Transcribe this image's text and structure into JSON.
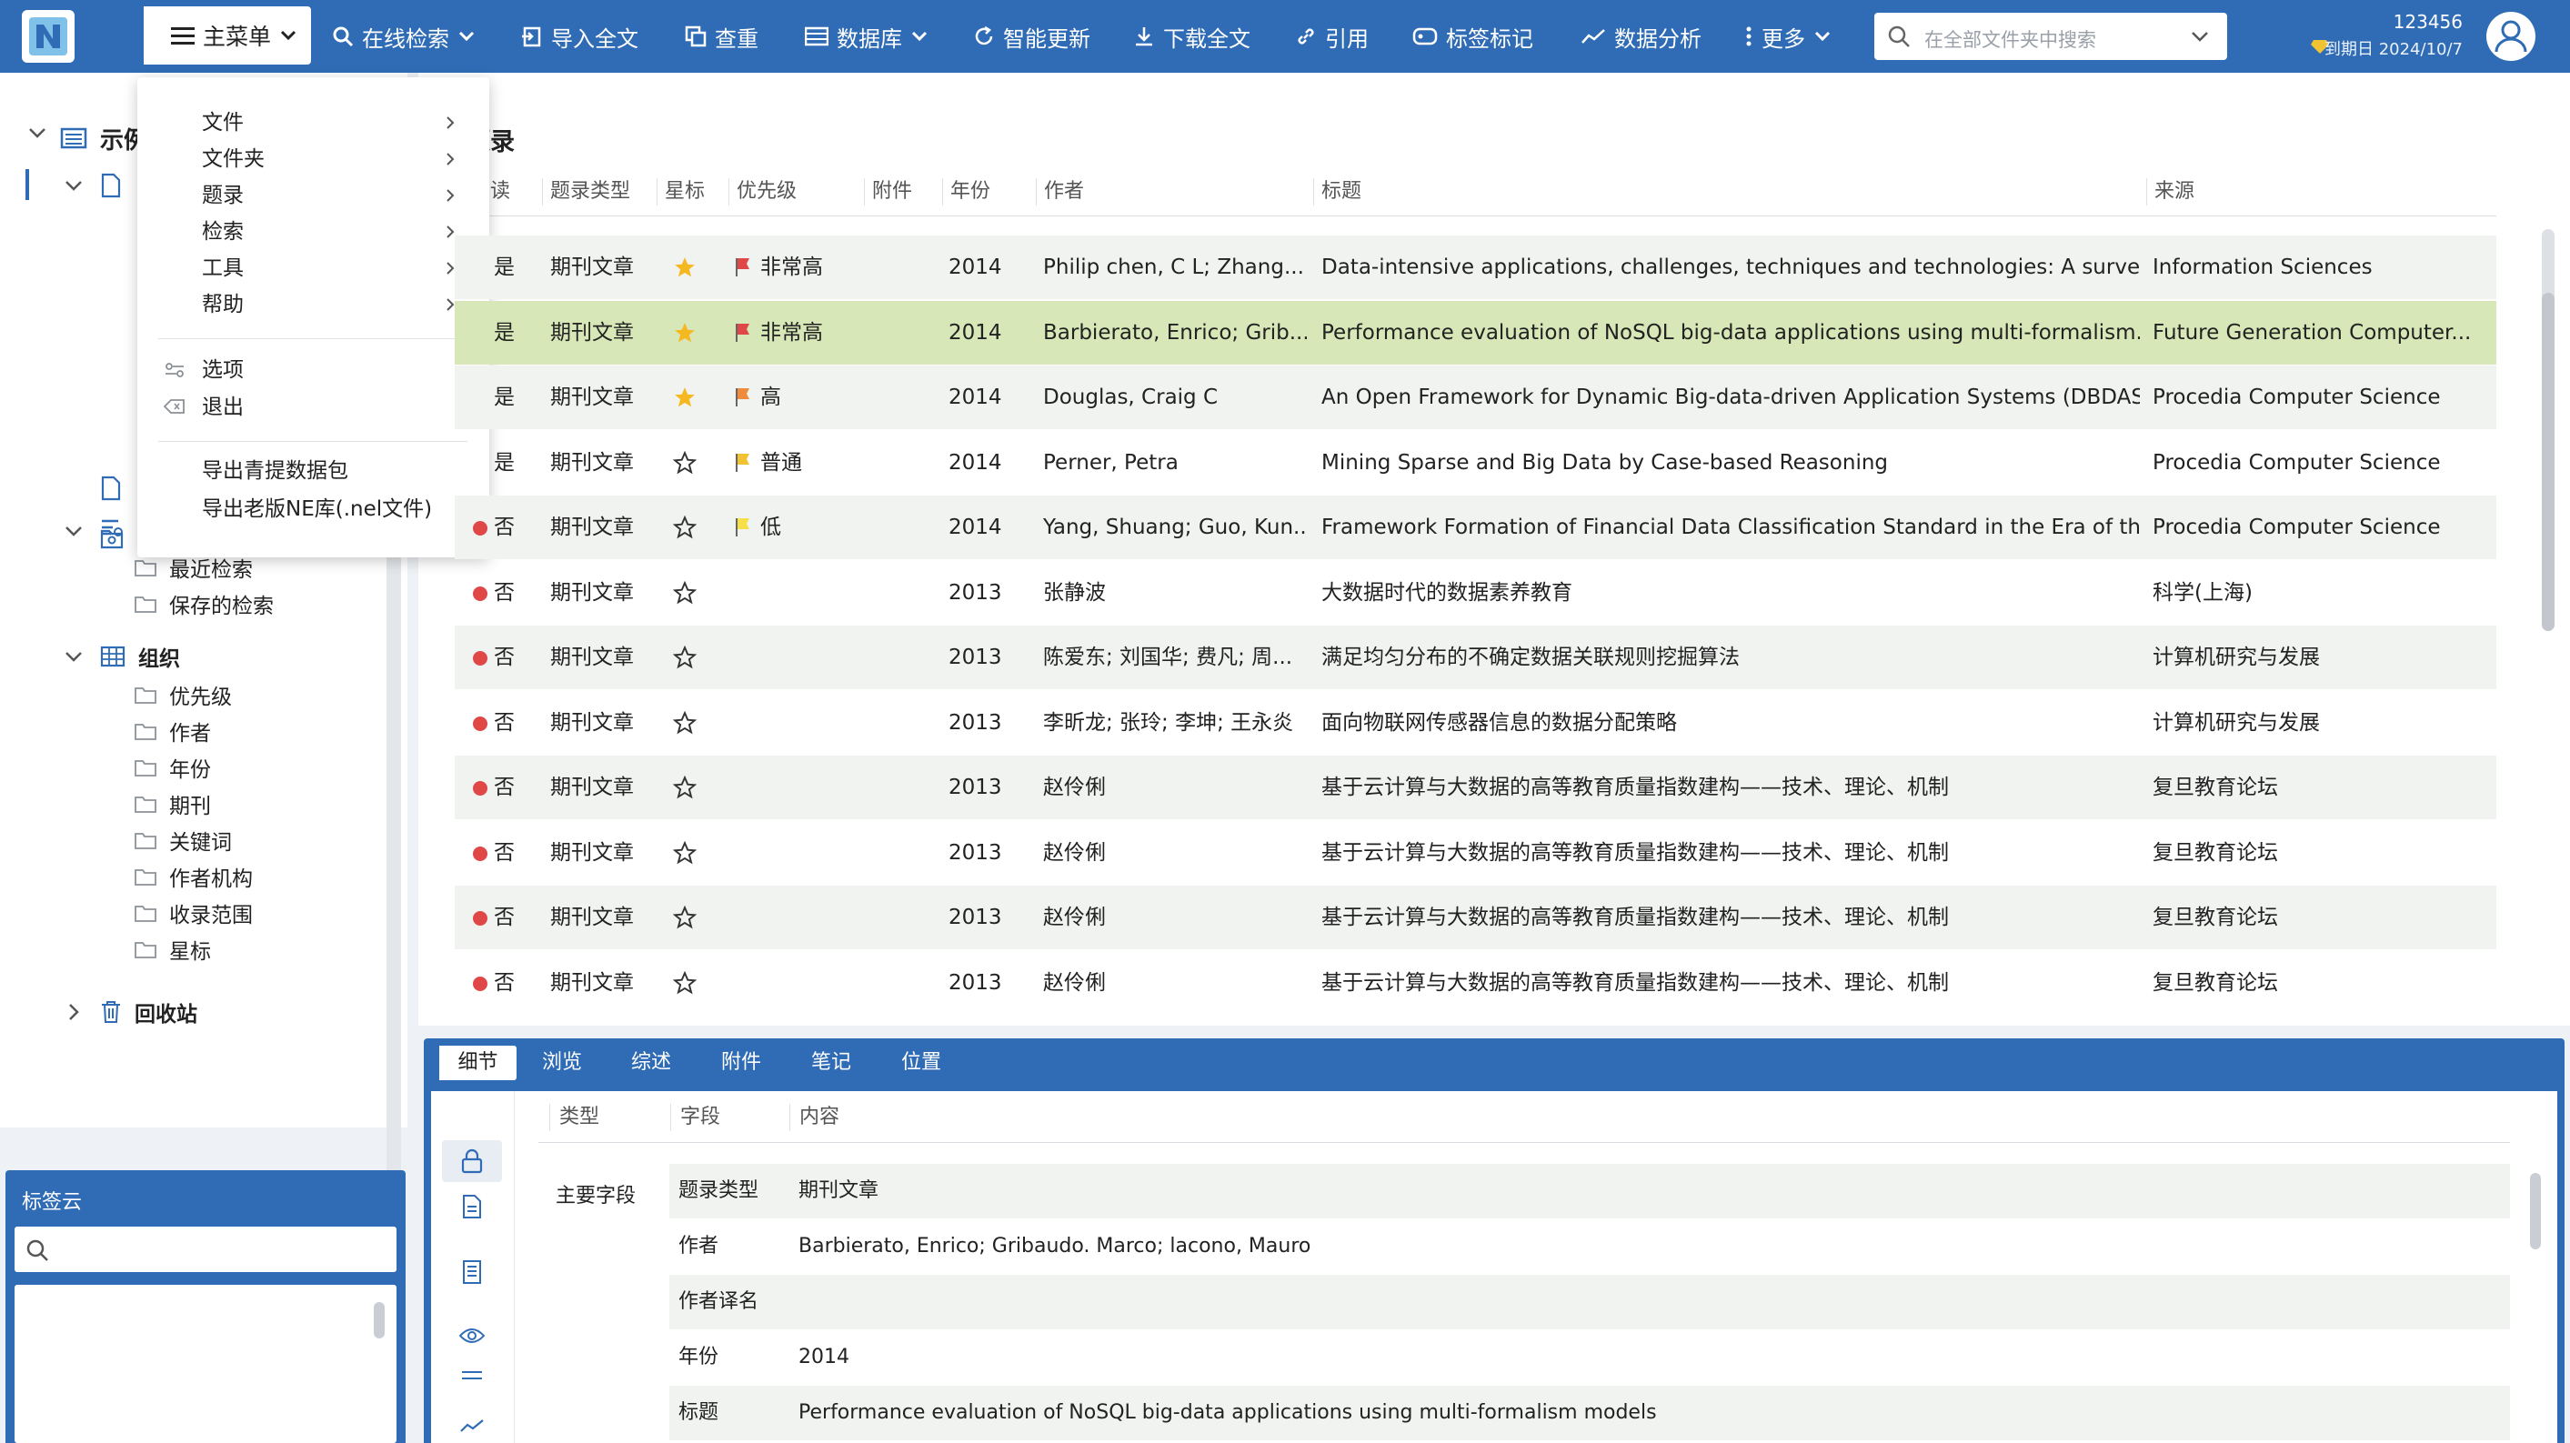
{
  "topbar": {
    "main_menu": "主菜单",
    "online_search": "在线检索",
    "import_fulltext": "导入全文",
    "dedupe": "查重",
    "database": "数据库",
    "smart_update": "智能更新",
    "download_fulltext": "下载全文",
    "cite": "引用",
    "tag_mark": "标签标记",
    "data_analysis": "数据分析",
    "more": "更多",
    "search_placeholder": "在全部文件夹中搜索",
    "user_id": "123456",
    "expiry": "到期日 2024/10/7"
  },
  "dropdown": {
    "items": [
      {
        "label": "文件"
      },
      {
        "label": "文件夹"
      },
      {
        "label": "题录"
      },
      {
        "label": "检索"
      },
      {
        "label": "工具"
      },
      {
        "label": "帮助"
      }
    ],
    "options": "选项",
    "exit": "退出",
    "export_qingti": "导出青提数据包",
    "export_old_ne": "导出老版NE库(.nel文件)"
  },
  "tree": {
    "root_label": "示例",
    "recent_search": "最近检索",
    "saved_search": "保存的检索",
    "organize": "组织",
    "org_items": [
      {
        "label": "优先级"
      },
      {
        "label": "作者"
      },
      {
        "label": "年份"
      },
      {
        "label": "期刊"
      },
      {
        "label": "关键词"
      },
      {
        "label": "作者机构"
      },
      {
        "label": "收录范围"
      },
      {
        "label": "星标"
      }
    ],
    "recycle_bin": "回收站"
  },
  "tag_cloud": {
    "title": "标签云"
  },
  "list": {
    "title": "题录",
    "columns": {
      "read": "读",
      "type": "题录类型",
      "star": "星标",
      "priority": "优先级",
      "attach": "附件",
      "year": "年份",
      "author": "作者",
      "title": "标题",
      "source": "来源"
    },
    "rows": [
      {
        "read": "是",
        "type": "期刊文章",
        "starred": true,
        "flag": "#e04848",
        "priority": "非常高",
        "year": "2014",
        "author": "Philip chen, C L; Zhang...",
        "title": "Data-intensive applications, challenges, techniques and technologies: A survey...",
        "source": "Information Sciences"
      },
      {
        "read": "是",
        "type": "期刊文章",
        "starred": true,
        "flag": "#e04848",
        "priority": "非常高",
        "year": "2014",
        "author": "Barbierato, Enrico; Grib...",
        "title": "Performance evaluation of NoSQL big-data applications using multi-formalism...",
        "source": "Future Generation Computer..."
      },
      {
        "read": "是",
        "type": "期刊文章",
        "starred": true,
        "flag": "#f08a3c",
        "priority": "高",
        "year": "2014",
        "author": "Douglas, Craig C",
        "title": "An Open Framework for Dynamic Big-data-driven Application Systems (DBDAS...",
        "source": "Procedia Computer Science"
      },
      {
        "read": "是",
        "type": "期刊文章",
        "starred": false,
        "flag": "#f1c232",
        "priority": "普通",
        "year": "2014",
        "author": "Perner, Petra",
        "title": "Mining Sparse and Big Data by Case-based Reasoning",
        "source": "Procedia Computer Science"
      },
      {
        "read": "否",
        "type": "期刊文章",
        "starred": false,
        "flag": "#f5e04a",
        "priority": "低",
        "year": "2014",
        "author": "Yang, Shuang; Guo, Kun...",
        "title": "Framework Formation of Financial Data Classification Standard in the Era of the...",
        "source": "Procedia Computer Science"
      },
      {
        "read": "否",
        "type": "期刊文章",
        "starred": false,
        "flag": "",
        "priority": "",
        "year": "2013",
        "author": "张静波",
        "title": "大数据时代的数据素养教育",
        "source": "科学(上海)"
      },
      {
        "read": "否",
        "type": "期刊文章",
        "starred": false,
        "flag": "",
        "priority": "",
        "year": "2013",
        "author": "陈爱东; 刘国华; 费凡; 周...",
        "title": "满足均匀分布的不确定数据关联规则挖掘算法",
        "source": "计算机研究与发展"
      },
      {
        "read": "否",
        "type": "期刊文章",
        "starred": false,
        "flag": "",
        "priority": "",
        "year": "2013",
        "author": "李昕龙; 张玲; 李坤; 王永炎",
        "title": "面向物联网传感器信息的数据分配策略",
        "source": "计算机研究与发展"
      },
      {
        "read": "否",
        "type": "期刊文章",
        "starred": false,
        "flag": "",
        "priority": "",
        "year": "2013",
        "author": "赵伶俐",
        "title": "基于云计算与大数据的高等教育质量指数建构——技术、理论、机制",
        "source": "复旦教育论坛"
      },
      {
        "read": "否",
        "type": "期刊文章",
        "starred": false,
        "flag": "",
        "priority": "",
        "year": "2013",
        "author": "赵伶俐",
        "title": "基于云计算与大数据的高等教育质量指数建构——技术、理论、机制",
        "source": "复旦教育论坛"
      },
      {
        "read": "否",
        "type": "期刊文章",
        "starred": false,
        "flag": "",
        "priority": "",
        "year": "2013",
        "author": "赵伶俐",
        "title": "基于云计算与大数据的高等教育质量指数建构——技术、理论、机制",
        "source": "复旦教育论坛"
      },
      {
        "read": "否",
        "type": "期刊文章",
        "starred": false,
        "flag": "",
        "priority": "",
        "year": "2013",
        "author": "赵伶俐",
        "title": "基于云计算与大数据的高等教育质量指数建构——技术、理论、机制",
        "source": "复旦教育论坛"
      }
    ]
  },
  "detail": {
    "tabs": [
      {
        "label": "细节"
      },
      {
        "label": "浏览"
      },
      {
        "label": "综述"
      },
      {
        "label": "附件"
      },
      {
        "label": "笔记"
      },
      {
        "label": "位置"
      }
    ],
    "columns": {
      "type": "类型",
      "field": "字段",
      "content": "内容"
    },
    "section": "主要字段",
    "fields": [
      {
        "field": "题录类型",
        "content": "期刊文章"
      },
      {
        "field": "作者",
        "content": "Barbierato, Enrico; Gribaudo. Marco; lacono, Mauro"
      },
      {
        "field": "作者译名",
        "content": ""
      },
      {
        "field": "年份",
        "content": "2014"
      },
      {
        "field": "标题",
        "content": "Performance evaluation of NoSQL big-data applications using multi-formalism models"
      }
    ]
  },
  "colors": {
    "brand": "#2f6cb5",
    "selected_row": "#d7e7b7",
    "unread_dot": "#e04848",
    "star": "#f5b820"
  },
  "icons": [
    "menu-icon",
    "search-icon",
    "import-icon",
    "dedupe-icon",
    "database-icon",
    "refresh-icon",
    "download-icon",
    "link-icon",
    "tag-icon",
    "chart-icon",
    "more-icon",
    "chevron-down-icon",
    "user-icon",
    "gem-icon",
    "folder-icon",
    "star-icon",
    "flag-icon",
    "lock-icon",
    "document-icon",
    "eye-icon",
    "trash-icon"
  ]
}
